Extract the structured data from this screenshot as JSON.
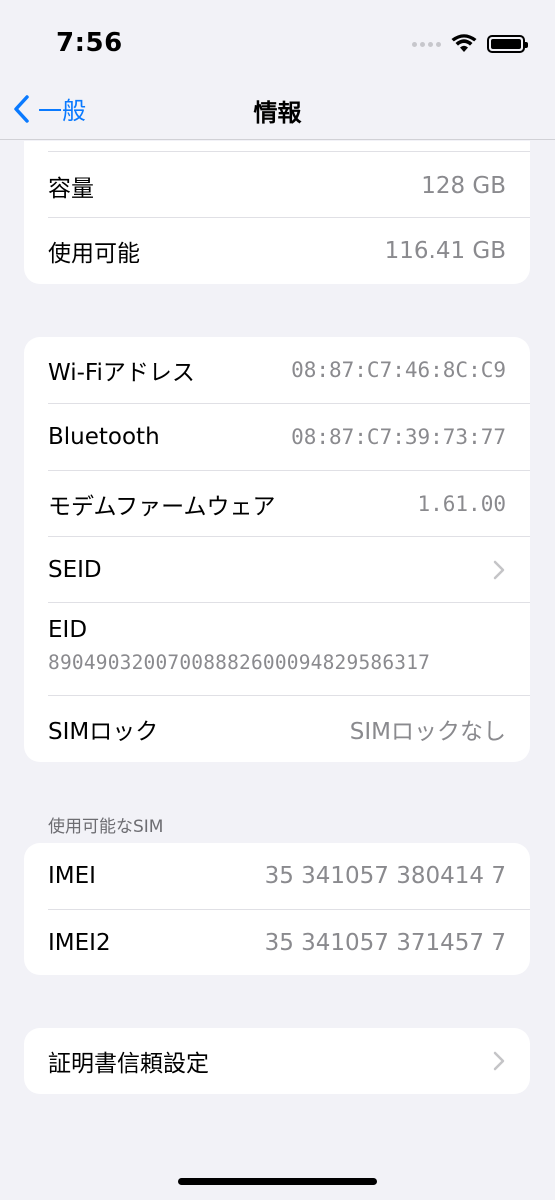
{
  "status_bar": {
    "time": "7:56"
  },
  "nav": {
    "back_label": "一般",
    "title": "情報"
  },
  "storage": [
    {
      "label": "容量",
      "value": "128 GB"
    },
    {
      "label": "使用可能",
      "value": "116.41 GB"
    }
  ],
  "network": {
    "wifi": {
      "label": "Wi-Fiアドレス",
      "value": "08:87:C7:46:8C:C9"
    },
    "bluetooth": {
      "label": "Bluetooth",
      "value": "08:87:C7:39:73:77"
    },
    "modem": {
      "label": "モデムファームウェア",
      "value": "1.61.00"
    },
    "seid": {
      "label": "SEID"
    },
    "eid": {
      "label": "EID",
      "value": "89049032007008882600094829586317"
    },
    "sim_lock": {
      "label": "SIMロック",
      "value": "SIMロックなし"
    }
  },
  "sim_section": {
    "header": "使用可能なSIM",
    "imei": {
      "label": "IMEI",
      "value": "35 341057 380414 7"
    },
    "imei2": {
      "label": "IMEI2",
      "value": "35 341057 371457 7"
    }
  },
  "certificate": {
    "label": "証明書信頼設定"
  },
  "colors": {
    "accent": "#0a7aff",
    "background": "#f2f2f7",
    "secondary_text": "#8a8a8e"
  }
}
